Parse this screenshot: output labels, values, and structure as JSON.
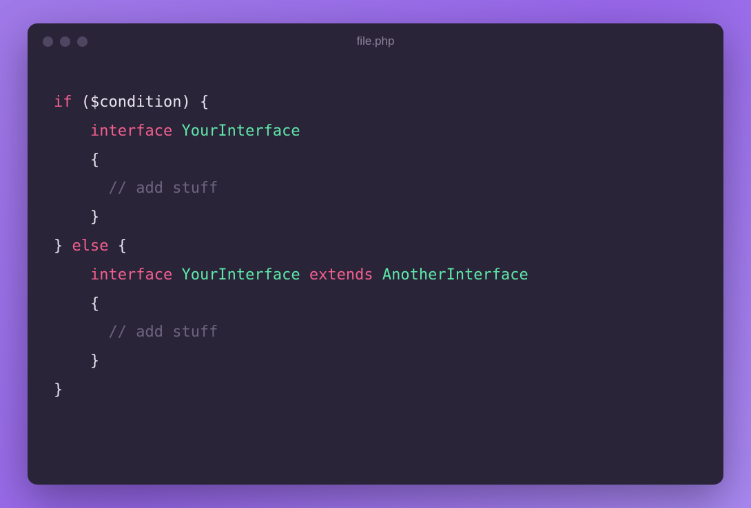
{
  "window": {
    "title": "file.php"
  },
  "code": {
    "tokens": [
      [
        {
          "text": "if",
          "class": "keyword"
        },
        {
          "text": " ",
          "class": ""
        },
        {
          "text": "(",
          "class": "paren"
        },
        {
          "text": "$condition",
          "class": "variable"
        },
        {
          "text": ")",
          "class": "paren"
        },
        {
          "text": " ",
          "class": ""
        },
        {
          "text": "{",
          "class": "punct"
        }
      ],
      [
        {
          "text": "    ",
          "class": ""
        },
        {
          "text": "interface",
          "class": "keyword"
        },
        {
          "text": " ",
          "class": ""
        },
        {
          "text": "YourInterface",
          "class": "type"
        }
      ],
      [
        {
          "text": "    ",
          "class": ""
        },
        {
          "text": "{",
          "class": "punct"
        }
      ],
      [
        {
          "text": "      ",
          "class": ""
        },
        {
          "text": "// add stuff",
          "class": "comment"
        }
      ],
      [
        {
          "text": "    ",
          "class": ""
        },
        {
          "text": "}",
          "class": "punct"
        }
      ],
      [
        {
          "text": "}",
          "class": "punct"
        },
        {
          "text": " ",
          "class": ""
        },
        {
          "text": "else",
          "class": "keyword"
        },
        {
          "text": " ",
          "class": ""
        },
        {
          "text": "{",
          "class": "punct"
        }
      ],
      [
        {
          "text": "    ",
          "class": ""
        },
        {
          "text": "interface",
          "class": "keyword"
        },
        {
          "text": " ",
          "class": ""
        },
        {
          "text": "YourInterface",
          "class": "type"
        },
        {
          "text": " ",
          "class": ""
        },
        {
          "text": "extends",
          "class": "keyword"
        },
        {
          "text": " ",
          "class": ""
        },
        {
          "text": "AnotherInterface",
          "class": "type"
        }
      ],
      [
        {
          "text": "    ",
          "class": ""
        },
        {
          "text": "{",
          "class": "punct"
        }
      ],
      [
        {
          "text": "      ",
          "class": ""
        },
        {
          "text": "// add stuff",
          "class": "comment"
        }
      ],
      [
        {
          "text": "    ",
          "class": ""
        },
        {
          "text": "}",
          "class": "punct"
        }
      ],
      [
        {
          "text": "}",
          "class": "punct"
        }
      ]
    ]
  }
}
